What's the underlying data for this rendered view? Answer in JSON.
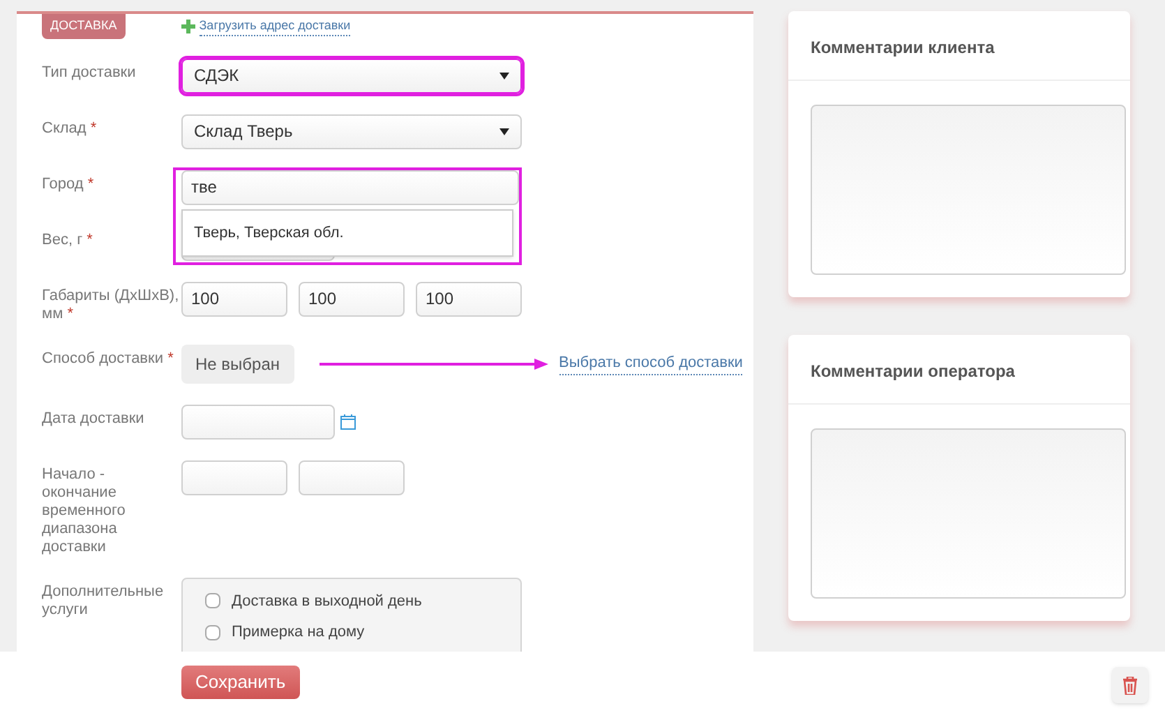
{
  "section_tab": "ДОСТАВКА",
  "load_address_link": "Загрузить адрес доставки",
  "fields": [
    {
      "kind": "select",
      "label": "Тип доставки",
      "value": "СДЭК",
      "highlighted": true
    },
    {
      "kind": "select",
      "label": "Склад",
      "marker": "*",
      "value": "Склад Тверь",
      "highlighted": false
    },
    {
      "kind": "autocomplete",
      "label": "Город",
      "marker": "*",
      "value": "тве",
      "highlighted": true,
      "suggestions": [
        "Тверь, Тверская обл."
      ]
    },
    {
      "kind": "text",
      "label": "Вес, г",
      "marker": "*"
    },
    {
      "kind": "triple",
      "label": "Габариты (ДхШхВ), мм",
      "marker": "*",
      "values": [
        "100",
        "100",
        "100"
      ]
    },
    {
      "kind": "method",
      "label": "Способ доставки",
      "marker": "*",
      "value": "Не выбран",
      "link": "Выбрать способ доставки"
    },
    {
      "kind": "date",
      "label": "Дата доставки"
    },
    {
      "kind": "range",
      "label": "Начало - окончание временного диапазона доставки"
    },
    {
      "kind": "options",
      "label": "Дополнительные услуги",
      "options": [
        {
          "label": "Доставка в выходной день",
          "checked": false
        },
        {
          "label": "Примерка на дому",
          "checked": false
        }
      ]
    }
  ],
  "comment_cards": [
    {
      "title": "Комментарии клиента"
    },
    {
      "title": "Комментарии оператора"
    }
  ],
  "save_button": "Сохранить"
}
